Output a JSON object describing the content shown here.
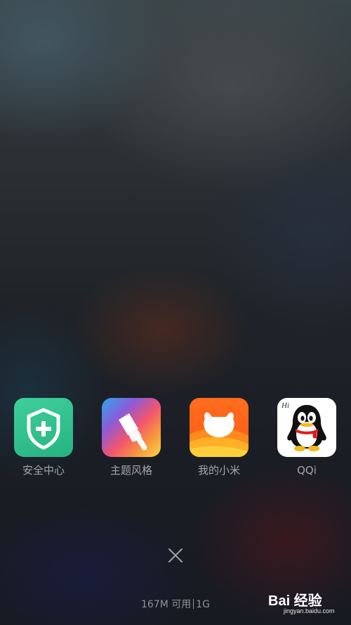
{
  "recents": {
    "apps": [
      {
        "label": "安全中心",
        "icon": "shield-plus-icon",
        "color": "#2dbd8c"
      },
      {
        "label": "主题风格",
        "icon": "paintbrush-icon",
        "color": "#f2556f"
      },
      {
        "label": "我的小米",
        "icon": "mi-bunny-icon",
        "color": "#ff6010"
      },
      {
        "label": "QQi",
        "icon": "qq-penguin-icon",
        "color": "#ffffff"
      }
    ],
    "close_icon": "close-icon",
    "memory": {
      "available": "167M 可用",
      "total": "1G"
    }
  },
  "watermark": {
    "brand": "Bai 经验",
    "url": "jingyan.baidu.com"
  }
}
